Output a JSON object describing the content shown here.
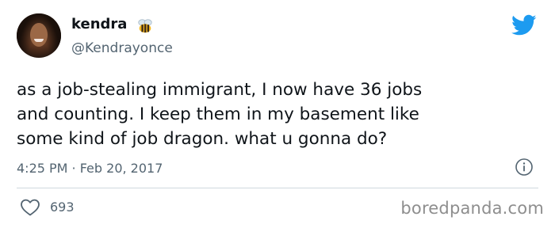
{
  "tweet": {
    "display_name": "kendra",
    "handle": "@Kendrayonce",
    "badge_icon": "bee-icon",
    "platform_icon": "twitter-bird-icon",
    "text_lines": [
      "as a job-stealing immigrant, I now have 36 jobs",
      "and counting. I keep them in my basement like",
      "some kind of job dragon. what u gonna do?"
    ],
    "timestamp": "4:25 PM · Feb 20, 2017",
    "info_icon": "info-icon",
    "like_icon": "heart-icon",
    "like_count": "693"
  },
  "watermark": "boredpanda.com",
  "colors": {
    "twitter_blue": "#1d9bf0",
    "secondary_text": "#536471",
    "divider": "#cfd9de"
  }
}
